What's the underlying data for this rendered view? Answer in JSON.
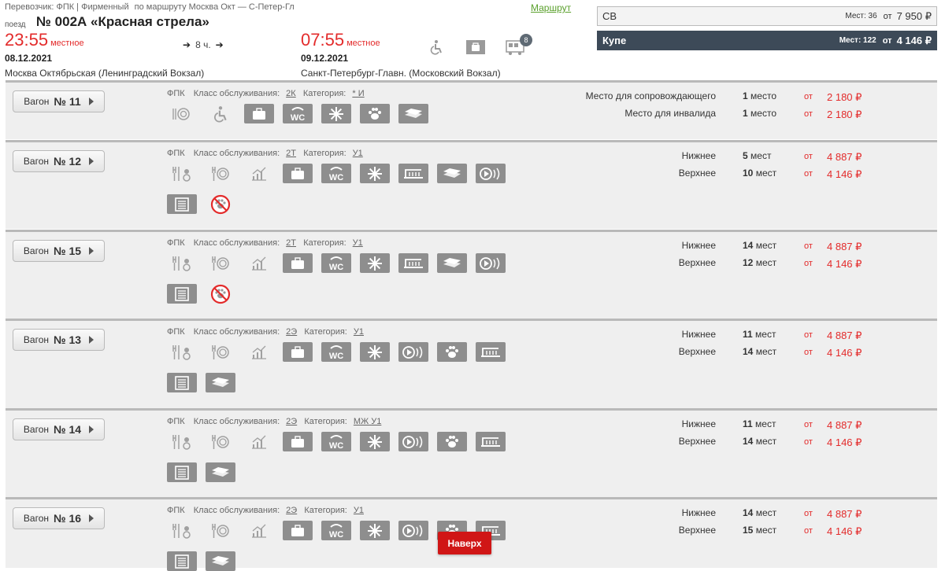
{
  "header": {
    "carrier": "Перевозчик: ФПК | Фирменный",
    "route_text": "по маршруту Москва Окт — С-Петер-Гл",
    "train_word": "поезд",
    "train_name": "№ 002А «Красная стрела»",
    "route_link": "Маршрут",
    "departure": {
      "time": "23:55",
      "local": "местное",
      "date": "08.12.2021",
      "station": "Москва Октябрьская (Ленинградский Вокзал)"
    },
    "duration": "8 ч.",
    "arrival": {
      "time": "07:55",
      "local": "местное",
      "date": "09.12.2021",
      "station": "Санкт-Петербург-Главн. (Московский Вокзал)"
    },
    "badge_count": "8"
  },
  "classes": [
    {
      "name": "СВ",
      "seats": "Мест: 36",
      "ot": "от",
      "price": "7 950 ₽"
    },
    {
      "name": "Купе",
      "seats": "Мест: 122",
      "ot": "от",
      "price": "4 146 ₽"
    }
  ],
  "wagon_label": "Вагон",
  "info_labels": {
    "carrier": "ФПК",
    "service": "Класс обслуживания:",
    "category": "Категория:"
  },
  "wagons": [
    {
      "num": "№ 11",
      "service": "2К",
      "category": "* И",
      "seats": [
        {
          "name": "Место для сопровождающего",
          "count": "1",
          "unit": "место",
          "ot": "от",
          "price": "2 180 ₽"
        },
        {
          "name": "Место для инвалида",
          "count": "1",
          "unit": "место",
          "ot": "от",
          "price": "2 180 ₽"
        }
      ]
    },
    {
      "num": "№ 12",
      "service": "2Т",
      "category": "У1",
      "seats": [
        {
          "name": "Нижнее",
          "count": "5",
          "unit": "мест",
          "ot": "от",
          "price": "4 887 ₽"
        },
        {
          "name": "Верхнее",
          "count": "10",
          "unit": "мест",
          "ot": "от",
          "price": "4 146 ₽"
        }
      ]
    },
    {
      "num": "№ 15",
      "service": "2Т",
      "category": "У1",
      "seats": [
        {
          "name": "Нижнее",
          "count": "14",
          "unit": "мест",
          "ot": "от",
          "price": "4 887 ₽"
        },
        {
          "name": "Верхнее",
          "count": "12",
          "unit": "мест",
          "ot": "от",
          "price": "4 146 ₽"
        }
      ]
    },
    {
      "num": "№ 13",
      "service": "2Э",
      "category": "У1",
      "seats": [
        {
          "name": "Нижнее",
          "count": "11",
          "unit": "мест",
          "ot": "от",
          "price": "4 887 ₽"
        },
        {
          "name": "Верхнее",
          "count": "14",
          "unit": "мест",
          "ot": "от",
          "price": "4 146 ₽"
        }
      ]
    },
    {
      "num": "№ 14",
      "service": "2Э",
      "category": "МЖ У1",
      "seats": [
        {
          "name": "Нижнее",
          "count": "11",
          "unit": "мест",
          "ot": "от",
          "price": "4 887 ₽"
        },
        {
          "name": "Верхнее",
          "count": "14",
          "unit": "мест",
          "ot": "от",
          "price": "4 146 ₽"
        }
      ]
    },
    {
      "num": "№ 16",
      "service": "2Э",
      "category": "У1",
      "seats": [
        {
          "name": "Нижнее",
          "count": "14",
          "unit": "мест",
          "ot": "от",
          "price": "4 887 ₽"
        },
        {
          "name": "Верхнее",
          "count": "15",
          "unit": "мест",
          "ot": "от",
          "price": "4 146 ₽"
        }
      ]
    }
  ],
  "up_button": "Наверх"
}
